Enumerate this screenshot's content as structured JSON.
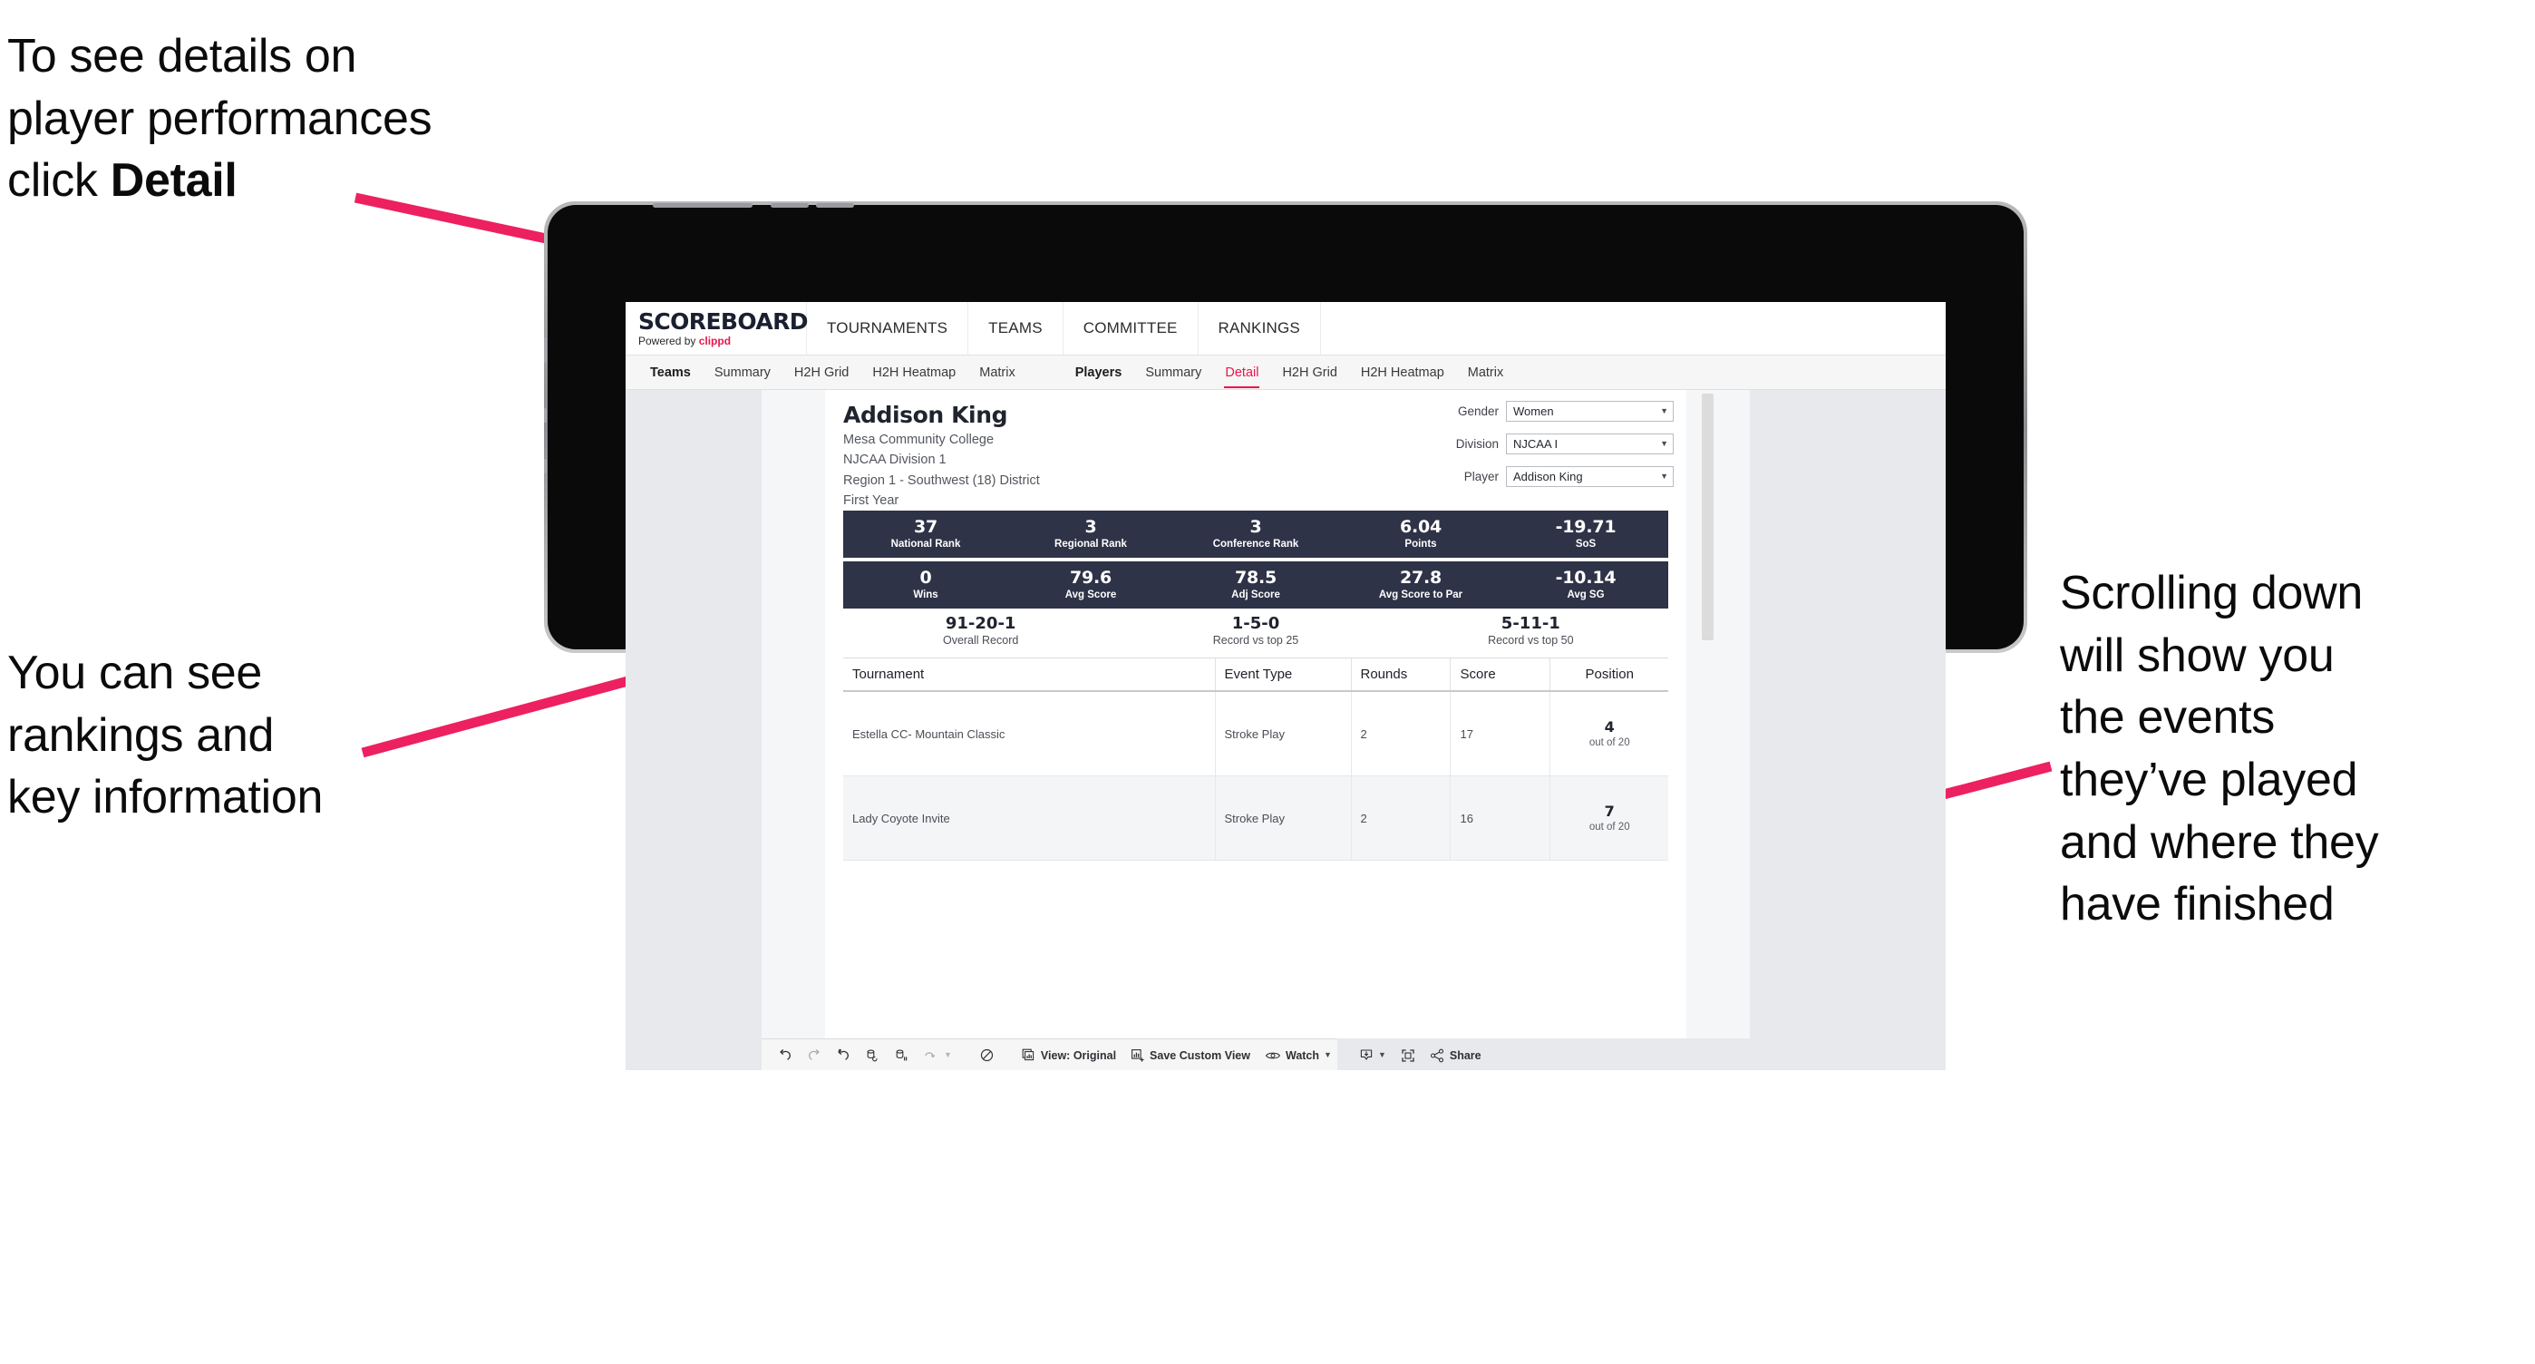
{
  "annotations": {
    "top_left": "To see details on\nplayer performances\nclick ",
    "top_left_bold": "Detail",
    "mid_left": "You can see\nrankings and\nkey information",
    "right": "Scrolling down\nwill show you\nthe events\nthey’ve played\nand where they\nhave finished"
  },
  "colors": {
    "accent_pink": "#e8174c",
    "navy": "#2e3347",
    "canvas_grey": "#e7e9ec"
  },
  "app": {
    "brand": {
      "name": "SCOREBOARD",
      "powered_prefix": "Powered by ",
      "powered_brand": "clippd"
    },
    "topnav": [
      "TOURNAMENTS",
      "TEAMS",
      "COMMITTEE",
      "RANKINGS"
    ],
    "subnav": {
      "teams_group": {
        "head": "Teams",
        "items": [
          "Summary",
          "H2H Grid",
          "H2H Heatmap",
          "Matrix"
        ]
      },
      "players_group": {
        "head": "Players",
        "items": [
          "Summary",
          "Detail",
          "H2H Grid",
          "H2H Heatmap",
          "Matrix"
        ],
        "active": "Detail"
      }
    },
    "player": {
      "name": "Addison King",
      "school": "Mesa Community College",
      "division": "NJCAA Division 1",
      "region": "Region 1 - Southwest (18) District",
      "year": "First Year"
    },
    "filters": [
      {
        "label": "Gender",
        "value": "Women"
      },
      {
        "label": "Division",
        "value": "NJCAA I"
      },
      {
        "label": "Player",
        "value": "Addison King"
      }
    ],
    "stats_row_1": [
      {
        "value": "37",
        "label": "National Rank"
      },
      {
        "value": "3",
        "label": "Regional Rank"
      },
      {
        "value": "3",
        "label": "Conference Rank"
      },
      {
        "value": "6.04",
        "label": "Points"
      },
      {
        "value": "-19.71",
        "label": "SoS"
      }
    ],
    "stats_row_2": [
      {
        "value": "0",
        "label": "Wins"
      },
      {
        "value": "79.6",
        "label": "Avg Score"
      },
      {
        "value": "78.5",
        "label": "Adj Score"
      },
      {
        "value": "27.8",
        "label": "Avg Score to Par"
      },
      {
        "value": "-10.14",
        "label": "Avg SG"
      }
    ],
    "records": [
      {
        "value": "91-20-1",
        "label": "Overall Record"
      },
      {
        "value": "1-5-0",
        "label": "Record vs top 25"
      },
      {
        "value": "5-11-1",
        "label": "Record vs top 50"
      }
    ],
    "events_table": {
      "headers": [
        "Tournament",
        "Event Type",
        "Rounds",
        "Score",
        "Position"
      ],
      "rows": [
        {
          "tournament": "Estella CC- Mountain Classic",
          "event_type": "Stroke Play",
          "rounds": "2",
          "score": "17",
          "position": "4",
          "position_sub": "out of 20"
        },
        {
          "tournament": "Lady Coyote Invite",
          "event_type": "Stroke Play",
          "rounds": "2",
          "score": "16",
          "position": "7",
          "position_sub": "out of 20"
        }
      ]
    },
    "toolbar": {
      "view_label": "View: Original",
      "save_label": "Save Custom View",
      "watch_label": "Watch",
      "share_label": "Share"
    }
  }
}
